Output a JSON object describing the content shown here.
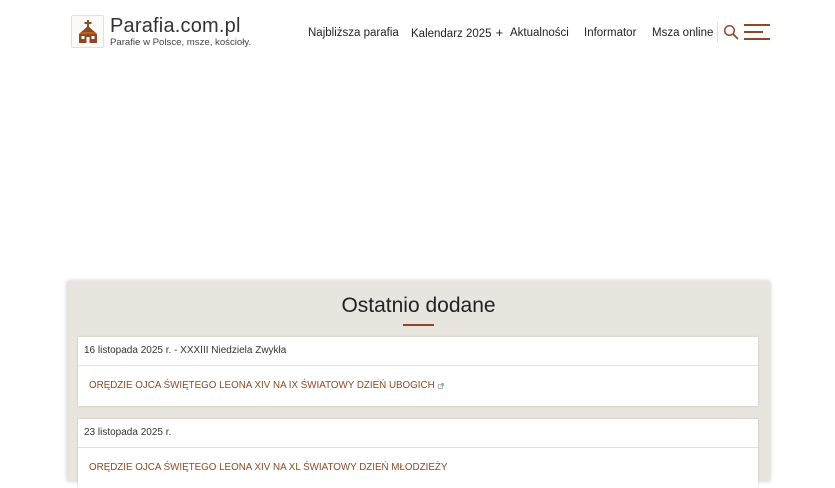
{
  "site": {
    "title": "Parafia.com.pl",
    "tagline": "Parafie w Polsce, msze, kościoły."
  },
  "nav": [
    {
      "label": "Najbliższa parafia"
    },
    {
      "label": "Kalendarz 2025",
      "expand": "+"
    },
    {
      "label": "Aktualności"
    },
    {
      "label": "Informator"
    },
    {
      "label": "Msza online"
    }
  ],
  "colors": {
    "accent": "#8b4a25",
    "panel_bg": "#e8e5de"
  },
  "icons": {
    "logo": "church-icon",
    "search": "search-icon",
    "menu": "hamburger-menu-icon",
    "external": "external-link-icon"
  },
  "recent": {
    "heading": "Ostatnio dodane",
    "items": [
      {
        "date": "16 listopada 2025 r. - XXXIII Niedziela Zwykła",
        "link": "ORĘDZIE OJCA ŚWIĘTEGO LEONA XIV NA IX ŚWIATOWY DZIEŃ UBOGICH"
      },
      {
        "date": "23 listopada 2025 r.",
        "link": "ORĘDZIE OJCA ŚWIĘTEGO LEONA XIV NA XL ŚWIATOWY DZIEŃ MŁODZIEŻY"
      }
    ]
  }
}
